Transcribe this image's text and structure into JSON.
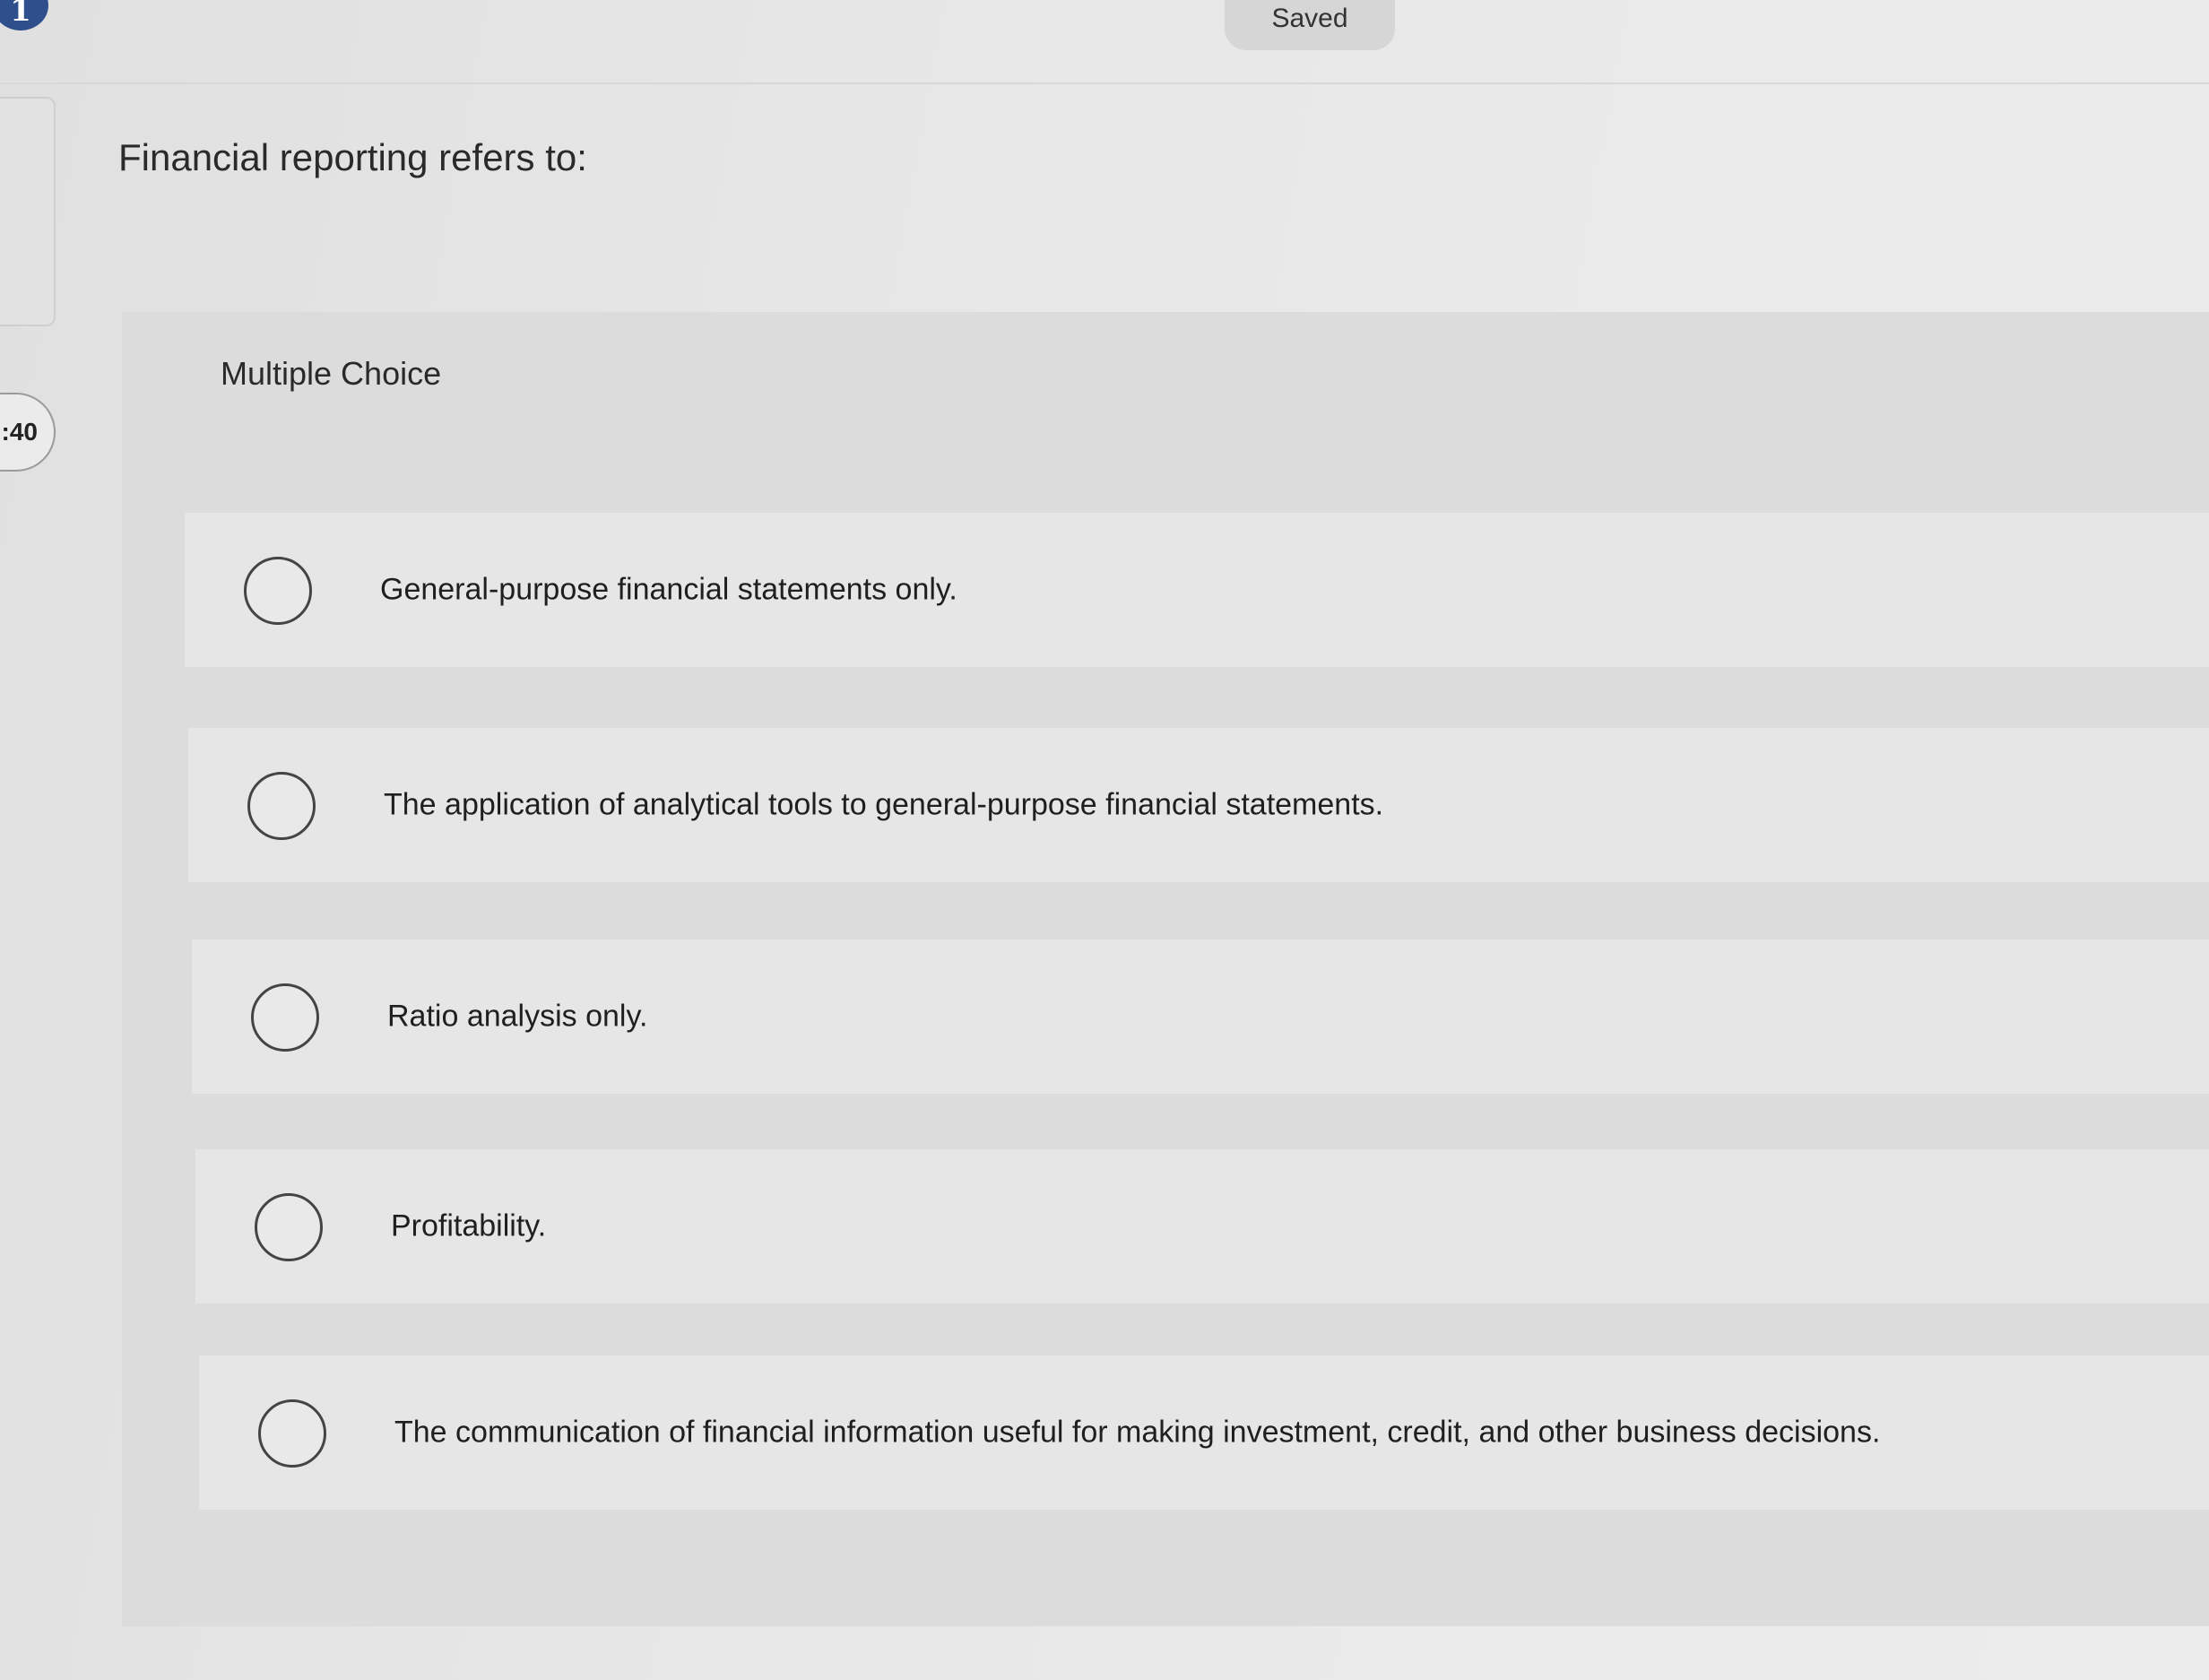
{
  "header": {
    "question_number": "1",
    "save_status": "Saved"
  },
  "sidebar": {
    "timer_text": ":40"
  },
  "question": {
    "prompt": "Financial reporting refers to:",
    "type_label": "Multiple Choice",
    "options": [
      "General-purpose financial statements only.",
      "The application of analytical tools to general-purpose financial statements.",
      "Ratio analysis only.",
      "Profitability.",
      "The communication of financial information useful for making investment, credit, and other business decisions."
    ]
  },
  "colors": {
    "badge": "#2f4f8c",
    "background": "#e4e4e4",
    "answer_panel": "#dcdcdc",
    "option_row": "#e6e6e6"
  }
}
